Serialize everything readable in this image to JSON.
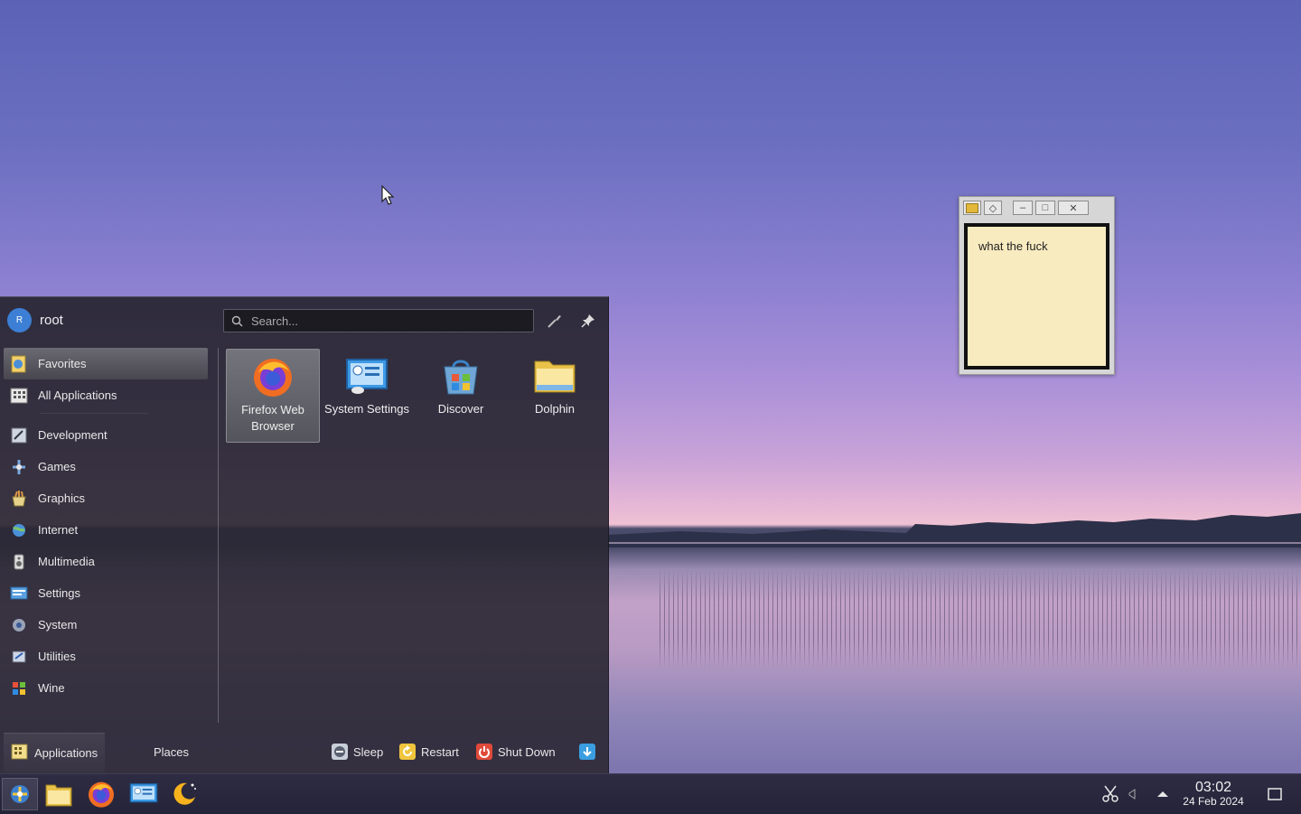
{
  "note": {
    "text": "what the fuck"
  },
  "menu": {
    "user": {
      "initial": "R",
      "name": "root"
    },
    "search": {
      "placeholder": "Search..."
    },
    "categories": [
      {
        "label": "Favorites"
      },
      {
        "label": "All Applications"
      },
      {
        "label": "Development"
      },
      {
        "label": "Games"
      },
      {
        "label": "Graphics"
      },
      {
        "label": "Internet"
      },
      {
        "label": "Multimedia"
      },
      {
        "label": "Settings"
      },
      {
        "label": "System"
      },
      {
        "label": "Utilities"
      },
      {
        "label": "Wine"
      }
    ],
    "apps": [
      {
        "label": "Firefox Web Browser"
      },
      {
        "label": "System Settings"
      },
      {
        "label": "Discover"
      },
      {
        "label": "Dolphin"
      }
    ],
    "tabs": {
      "applications": "Applications",
      "places": "Places"
    },
    "actions": {
      "sleep": "Sleep",
      "restart": "Restart",
      "shutdown": "Shut Down"
    }
  },
  "taskbar": {
    "time": "03:02",
    "date": "24 Feb 2024"
  }
}
